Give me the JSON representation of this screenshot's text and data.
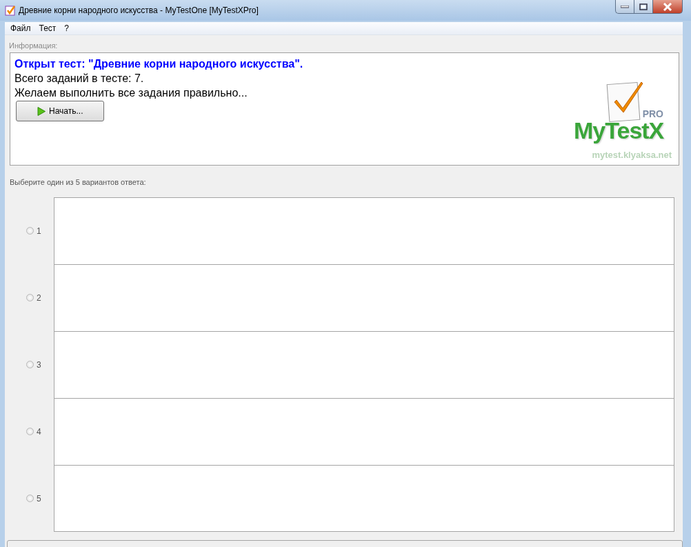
{
  "window": {
    "title": "Древние корни народного искусства - MyTestOne [MyTestXPro]"
  },
  "menu": [
    "Файл",
    "Тест",
    "?"
  ],
  "info": {
    "label": "Информация:",
    "heading": "Открыт тест: \"Древние корни народного искусства\".",
    "lines": [
      "Всего заданий в тесте: 7.",
      "Желаем выполнить все задания правильно..."
    ],
    "start_button": "Начать...",
    "logo": {
      "badge": "PRO",
      "name": "MyTestX",
      "url": "mytest.klyaksa.net"
    }
  },
  "question": {
    "prompt": "Выберите один из 5 вариантов ответа:",
    "options": [
      {
        "label": "1",
        "selected": false
      },
      {
        "label": "2",
        "selected": false
      },
      {
        "label": "3",
        "selected": false
      },
      {
        "label": "4",
        "selected": false
      },
      {
        "label": "5",
        "selected": false
      }
    ]
  }
}
